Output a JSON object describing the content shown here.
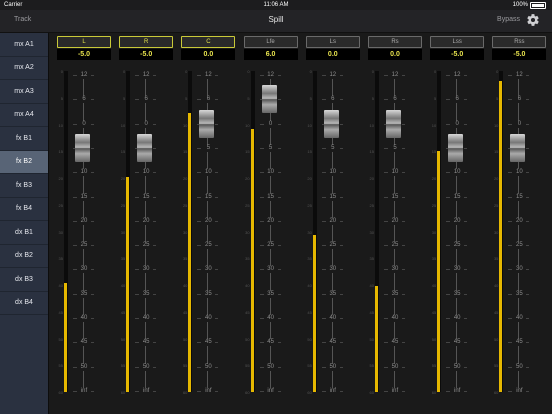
{
  "status": {
    "carrier": "Carrier",
    "time": "11:06 AM",
    "battery": "100%"
  },
  "nav": {
    "back_label": "Track",
    "title": "Spill",
    "bypass_label": "Bypass",
    "settings_icon": "gear-icon"
  },
  "sidebar": {
    "items": [
      {
        "label": "mx A1"
      },
      {
        "label": "mx A2"
      },
      {
        "label": "mx A3"
      },
      {
        "label": "mx A4"
      },
      {
        "label": "fx B1"
      },
      {
        "label": "fx B2"
      },
      {
        "label": "fx B3"
      },
      {
        "label": "fx B4"
      },
      {
        "label": "dx B1"
      },
      {
        "label": "dx B2"
      },
      {
        "label": "dx B3"
      },
      {
        "label": "dx B4"
      }
    ],
    "selected": "fx B2"
  },
  "scale": {
    "fader_labels": [
      "12",
      "6",
      "0",
      "5",
      "10",
      "15",
      "20",
      "25",
      "30",
      "35",
      "40",
      "45",
      "50",
      "inf"
    ],
    "meter_labels": [
      "0",
      "5",
      "10",
      "15",
      "20",
      "25",
      "30",
      "35",
      "40",
      "45",
      "50",
      "55",
      "60"
    ]
  },
  "colors": {
    "meter": "#e6b800",
    "active_button": "#c9c938",
    "value_text": "#e9e44e"
  },
  "channels": [
    {
      "name": "L",
      "value": "-5.0",
      "active": true,
      "meter_level": 0.34
    },
    {
      "name": "R",
      "value": "-5.0",
      "active": true,
      "meter_level": 0.67
    },
    {
      "name": "C",
      "value": "0.0",
      "active": true,
      "meter_level": 0.87
    },
    {
      "name": "Lfe",
      "value": "6.0",
      "active": false,
      "meter_level": 0.82
    },
    {
      "name": "Ls",
      "value": "0.0",
      "active": false,
      "meter_level": 0.49
    },
    {
      "name": "Rs",
      "value": "0.0",
      "active": false,
      "meter_level": 0.33
    },
    {
      "name": "Lss",
      "value": "-5.0",
      "active": false,
      "meter_level": 0.75
    },
    {
      "name": "Rss",
      "value": "-5.0",
      "active": false,
      "meter_level": 0.97
    }
  ]
}
